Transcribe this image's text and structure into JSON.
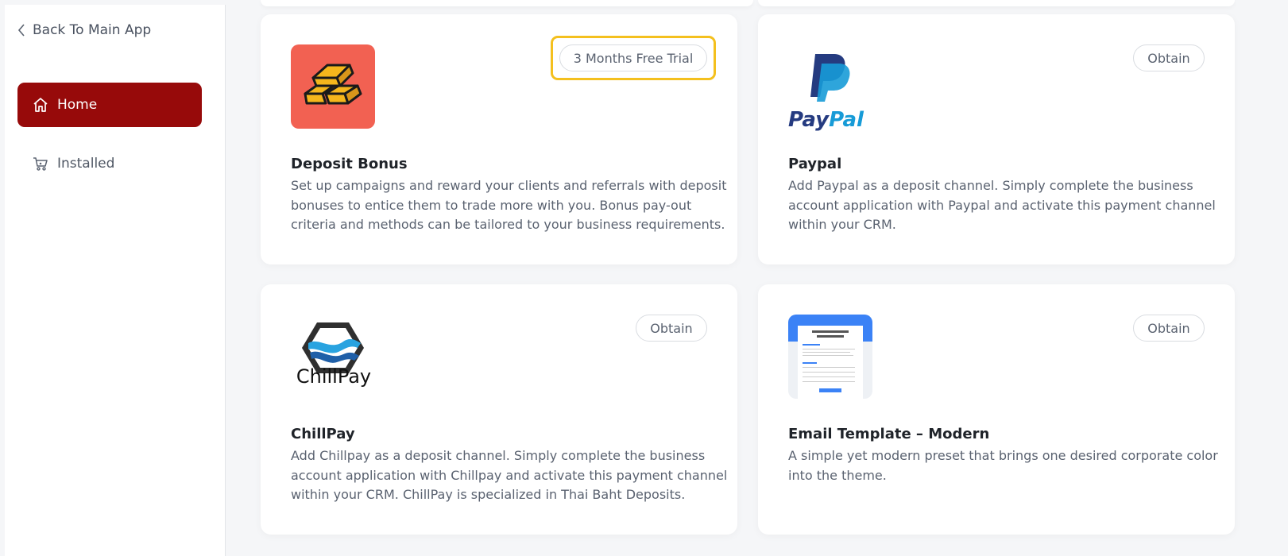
{
  "sidebar": {
    "back_label": "Back To Main App",
    "items": [
      {
        "label": "Home",
        "icon": "home-icon",
        "active": true
      },
      {
        "label": "Installed",
        "icon": "cart-icon",
        "active": false
      }
    ]
  },
  "colors": {
    "accent": "#970a0a",
    "highlight": "#f4c01e",
    "deposit_logo_bg": "#f26152",
    "gold": "#f5b61c",
    "paypal_dark": "#253b80",
    "paypal_light": "#179bd7",
    "email_blue": "#3b82f6"
  },
  "cards": [
    {
      "title": "Deposit Bonus",
      "description": "Set up campaigns and reward your clients and referrals with deposit bonuses to entice them to trade more with you. Bonus pay-out criteria and methods can be tailored to your business requirements.",
      "action": "3 Months Free Trial",
      "logo": "gold-bars-icon"
    },
    {
      "title": "Paypal",
      "description": "Add Paypal as a deposit channel. Simply complete the business account application with Paypal and activate this payment channel within your CRM.",
      "action": "Obtain",
      "logo": "paypal-logo",
      "logo_text": "PayPal"
    },
    {
      "title": "ChillPay",
      "description": "Add Chillpay as a deposit channel. Simply complete the business account application with Chillpay and activate this payment channel within your CRM. ChillPay is specialized in Thai Baht Deposits.",
      "action": "Obtain",
      "logo": "chillpay-logo",
      "logo_text": "ChillPay"
    },
    {
      "title": "Email Template – Modern",
      "description": "A simple yet modern preset that brings one desired corporate color into the theme.",
      "action": "Obtain",
      "logo": "email-template-thumbnail"
    }
  ]
}
